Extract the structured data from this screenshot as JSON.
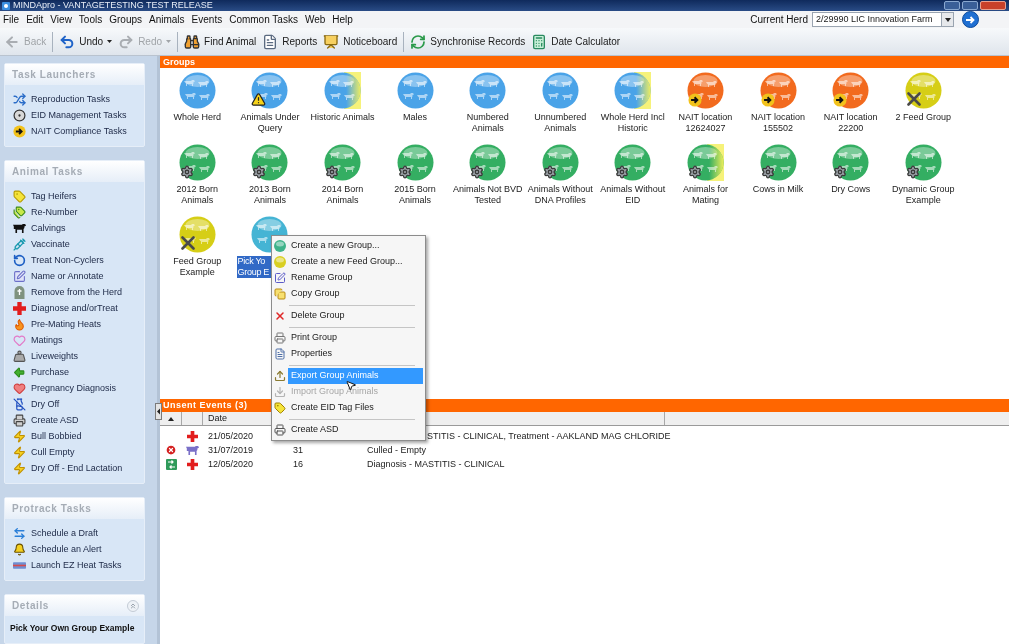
{
  "window": {
    "title": "MINDApro - VANTAGETESTING TEST RELEASE"
  },
  "menu_bar": [
    "File",
    "Edit",
    "View",
    "Tools",
    "Groups",
    "Animals",
    "Events",
    "Common Tasks",
    "Web",
    "Help"
  ],
  "current_herd": {
    "label": "Current Herd",
    "value": "2/29990 LIC Innovation Farm"
  },
  "toolbar": [
    [
      {
        "label": "Back",
        "disabled": true,
        "dropdown": false
      }
    ],
    [
      {
        "label": "Undo",
        "disabled": false,
        "dropdown": true
      },
      {
        "label": "Redo",
        "disabled": true,
        "dropdown": true
      }
    ],
    [
      {
        "label": "Find Animal",
        "disabled": false,
        "dropdown": false
      },
      {
        "label": "Reports",
        "disabled": false,
        "dropdown": false
      },
      {
        "label": "Noticeboard",
        "disabled": false,
        "dropdown": false
      }
    ],
    [
      {
        "label": "Synchronise Records",
        "disabled": false,
        "dropdown": false
      },
      {
        "label": "Date Calculator",
        "disabled": false,
        "dropdown": false
      }
    ]
  ],
  "sidebar": {
    "panels": [
      {
        "title": "Task Launchers",
        "items": [
          "Reproduction Tasks",
          "EID Management Tasks",
          "NAIT Compliance Tasks"
        ]
      },
      {
        "title": "Animal Tasks",
        "items": [
          "Tag Heifers",
          "Re-Number",
          "Calvings",
          "Vaccinate",
          "Treat Non-Cyclers",
          "Name or Annotate",
          "Remove from the Herd",
          "Diagnose and/orTreat",
          "Pre-Mating Heats",
          "Matings",
          "Liveweights",
          "Purchase",
          "Pregnancy Diagnosis",
          "Dry Off",
          "Create ASD",
          "Bull Bobbied",
          "Cull Empty",
          "Dry Off - End Lactation"
        ]
      },
      {
        "title": "Protrack Tasks",
        "items": [
          "Schedule a Draft",
          "Schedule an Alert",
          "Launch EZ Heat Tasks"
        ]
      }
    ],
    "details": {
      "title": "Details",
      "value": "Pick Your Own Group Example"
    }
  },
  "groups": {
    "title": "Groups",
    "items": [
      {
        "kind": "plain",
        "label": "Whole Herd",
        "color": "#4aa3e8",
        "tinted": false,
        "selected": false
      },
      {
        "kind": "warning",
        "label": "Animals Under Query",
        "color": "#4aa3e8",
        "tinted": false,
        "selected": false
      },
      {
        "kind": "plain",
        "label": "Historic Animals",
        "color": "#4aa3e8",
        "tinted": true,
        "selected": false
      },
      {
        "kind": "plain",
        "label": "Males",
        "color": "#4aa3e8",
        "tinted": false,
        "selected": false
      },
      {
        "kind": "plain",
        "label": "Numbered Animals",
        "color": "#4aa3e8",
        "tinted": false,
        "selected": false
      },
      {
        "kind": "plain",
        "label": "Unnumbered Animals",
        "color": "#4aa3e8",
        "tinted": false,
        "selected": false
      },
      {
        "kind": "plain",
        "label": "Whole Herd Incl Historic",
        "color": "#4aa3e8",
        "tinted": true,
        "selected": false
      },
      {
        "kind": "arrow",
        "label": "NAIT location 12624027",
        "color": "#f26a1e",
        "tinted": false,
        "selected": false
      },
      {
        "kind": "arrow",
        "label": "NAIT location 155502",
        "color": "#f26a1e",
        "tinted": false,
        "selected": false
      },
      {
        "kind": "arrow",
        "label": "NAIT location 22200",
        "color": "#f26a1e",
        "tinted": false,
        "selected": false
      },
      {
        "kind": "tools",
        "label": "2 Feed Group",
        "color": "#d6ce16",
        "tinted": false,
        "selected": false
      },
      {
        "kind": "gear",
        "label": "2012 Born Animals",
        "color": "#34ae62",
        "tinted": false,
        "selected": false
      },
      {
        "kind": "gear",
        "label": "2013 Born Animals",
        "color": "#34ae62",
        "tinted": false,
        "selected": false
      },
      {
        "kind": "gear",
        "label": "2014 Born Animals",
        "color": "#34ae62",
        "tinted": false,
        "selected": false
      },
      {
        "kind": "gear",
        "label": "2015 Born Animals",
        "color": "#34ae62",
        "tinted": false,
        "selected": false
      },
      {
        "kind": "gear",
        "label": "Animals Not BVD Tested",
        "color": "#34ae62",
        "tinted": false,
        "selected": false
      },
      {
        "kind": "gear",
        "label": "Animals Without DNA Profiles",
        "color": "#34ae62",
        "tinted": false,
        "selected": false
      },
      {
        "kind": "gear",
        "label": "Animals Without EID",
        "color": "#34ae62",
        "tinted": false,
        "selected": false
      },
      {
        "kind": "gear",
        "label": "Animals for Mating",
        "color": "#34ae62",
        "tinted": true,
        "selected": false
      },
      {
        "kind": "gear",
        "label": "Cows in Milk",
        "color": "#34ae62",
        "tinted": false,
        "selected": false
      },
      {
        "kind": "gear",
        "label": "Dry Cows",
        "color": "#34ae62",
        "tinted": false,
        "selected": false
      },
      {
        "kind": "gear",
        "label": "Dynamic Group Example",
        "color": "#34ae62",
        "tinted": false,
        "selected": false
      },
      {
        "kind": "tools",
        "label": "Feed Group Example",
        "color": "#d6ce16",
        "tinted": false,
        "selected": false
      },
      {
        "kind": "plain",
        "label": "Pick Yo Group E",
        "color": "#45b4d4",
        "tinted": false,
        "selected": true
      }
    ]
  },
  "context_menu": {
    "items": [
      {
        "kind": "item",
        "label": "Create a new Group...",
        "selected": false,
        "disabled": false
      },
      {
        "kind": "item",
        "label": "Create a new Feed Group...",
        "selected": false,
        "disabled": false
      },
      {
        "kind": "item",
        "label": "Rename Group",
        "selected": false,
        "disabled": false
      },
      {
        "kind": "item",
        "label": "Copy Group",
        "selected": false,
        "disabled": false
      },
      {
        "kind": "separator"
      },
      {
        "kind": "item",
        "label": "Delete Group",
        "selected": false,
        "disabled": false
      },
      {
        "kind": "separator"
      },
      {
        "kind": "item",
        "label": "Print Group",
        "selected": false,
        "disabled": false
      },
      {
        "kind": "item",
        "label": "Properties",
        "selected": false,
        "disabled": false
      },
      {
        "kind": "separator"
      },
      {
        "kind": "item",
        "label": "Export Group Animals",
        "selected": true,
        "disabled": false
      },
      {
        "kind": "item",
        "label": "Import Group Animals",
        "selected": false,
        "disabled": true
      },
      {
        "kind": "item",
        "label": "Create EID Tag Files",
        "selected": false,
        "disabled": false
      },
      {
        "kind": "separator"
      },
      {
        "kind": "item",
        "label": "Create ASD",
        "selected": false,
        "disabled": false
      }
    ]
  },
  "unsent_events": {
    "title": "Unsent Events (3)",
    "columns": [
      "Date"
    ],
    "rows": [
      {
        "kind": "health",
        "date": "21/05/2020",
        "description": "STITIS - CLINICAL, Treatment - AAKLAND MAG CHLORIDE"
      },
      {
        "status": {
          "kind": "error"
        },
        "kind": "cull",
        "date": "31/07/2019",
        "number": "31",
        "description": "Culled - Empty"
      },
      {
        "status": {
          "kind": "sync"
        },
        "kind": "health",
        "date": "12/05/2020",
        "number": "16",
        "description": "Diagnosis - MASTITIS - CLINICAL"
      }
    ]
  }
}
